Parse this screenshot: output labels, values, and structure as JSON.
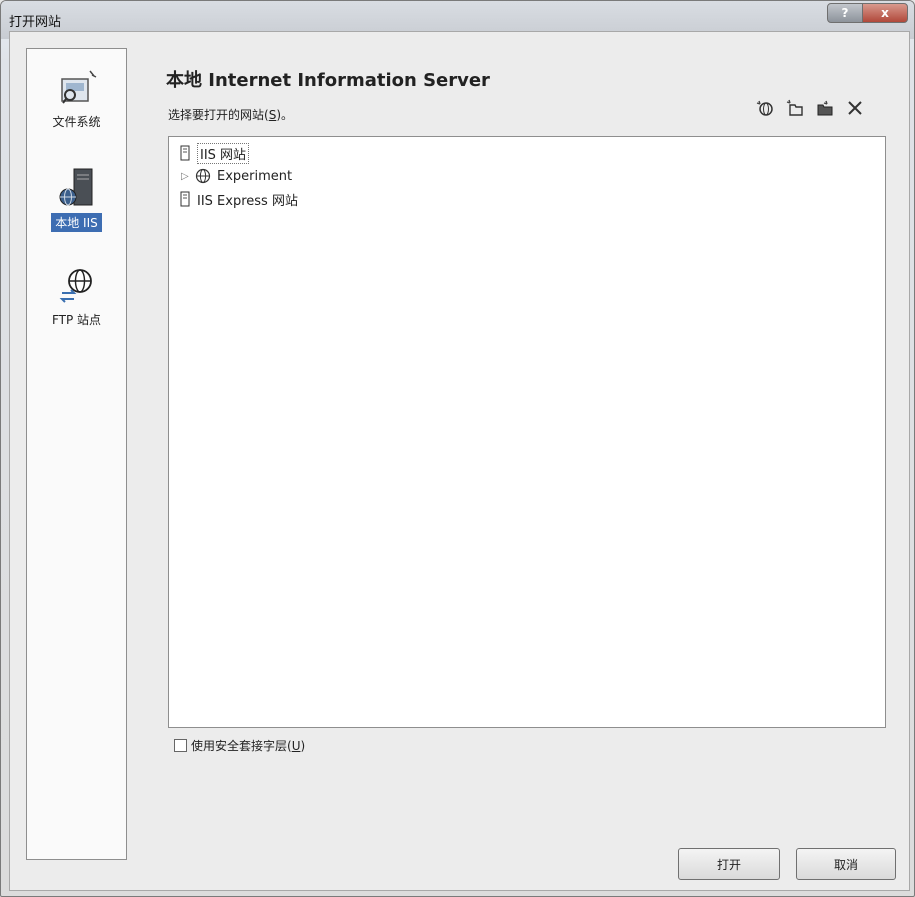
{
  "window": {
    "title": "打开网站",
    "help_label": "?",
    "close_label": "x"
  },
  "sidebar": {
    "items": [
      {
        "label": "文件系统",
        "icon": "file-system-icon"
      },
      {
        "label": "本地 IIS",
        "icon": "local-iis-icon",
        "selected": true
      },
      {
        "label": "FTP 站点",
        "icon": "ftp-site-icon"
      }
    ]
  },
  "header": {
    "title": "本地 Internet Information Server",
    "subtitle_text": "选择要打开的网站(",
    "subtitle_hotkey": "S",
    "subtitle_end": ")。"
  },
  "toolbar": {
    "icons": [
      "new-web-site-icon",
      "new-application-icon",
      "new-virtual-directory-icon",
      "delete-icon"
    ]
  },
  "tree": {
    "items": [
      {
        "label": "IIS 网站",
        "icon": "server-icon",
        "level": 0,
        "expander": "",
        "selected": true
      },
      {
        "label": "Experiment",
        "icon": "globe-icon",
        "level": 1,
        "expander": "▷"
      },
      {
        "label": "IIS Express 网站",
        "icon": "server-icon",
        "level": 0,
        "expander": ""
      }
    ]
  },
  "options": {
    "ssl_label": "使用安全套接字层(",
    "ssl_hotkey": "U",
    "ssl_end": ")",
    "ssl_checked": false
  },
  "buttons": {
    "open": "打开",
    "cancel": "取消"
  },
  "colors": {
    "selection": "#3d6db2",
    "close_button": "#b0483a"
  }
}
